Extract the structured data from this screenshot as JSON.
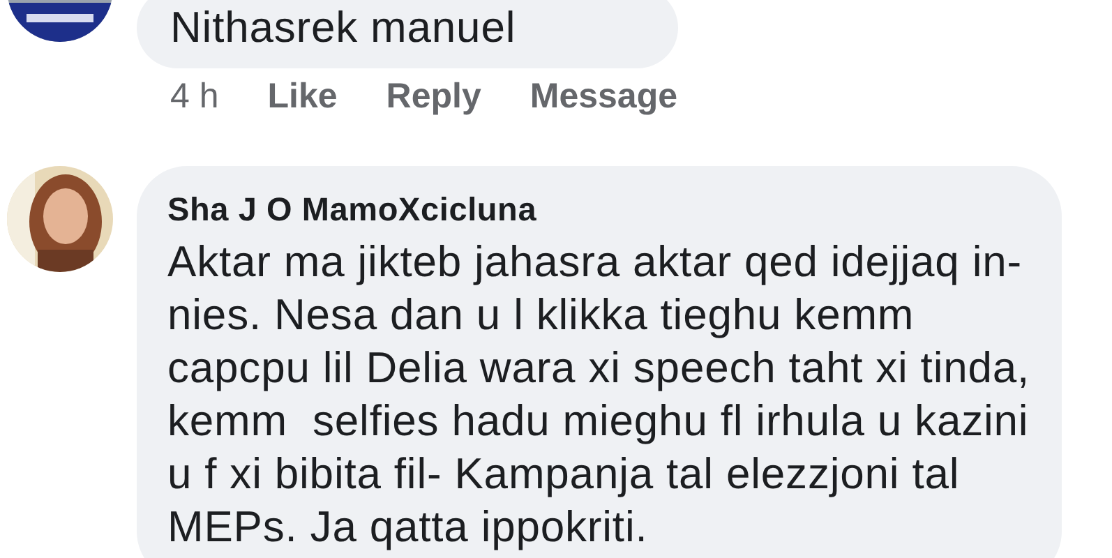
{
  "comments": [
    {
      "avatar": {
        "kind": "picture"
      },
      "lines": [
        "Nithasrek manuel"
      ],
      "actions": [
        {
          "kind": "time",
          "label": "4 h"
        },
        {
          "kind": "link",
          "label": "Like"
        },
        {
          "kind": "link",
          "label": "Reply"
        },
        {
          "kind": "link",
          "label": "Message"
        }
      ]
    },
    {
      "author": "Sha J O MamoXcicluna",
      "avatar": {
        "kind": "picture"
      },
      "lines": [
        "Aktar ma jikteb jahasra aktar qed idejjaq in-",
        "nies. Nesa dan u l klikka tieghu kemm",
        "capcpu lil Delia wara xi speech taht xi tinda,",
        "kemm  selfies hadu mieghu fl irhula u kazini",
        "u f xi bibita fil- Kampanja tal elezzjoni tal",
        "MEPs. Ja qatta ippokriti."
      ]
    }
  ]
}
